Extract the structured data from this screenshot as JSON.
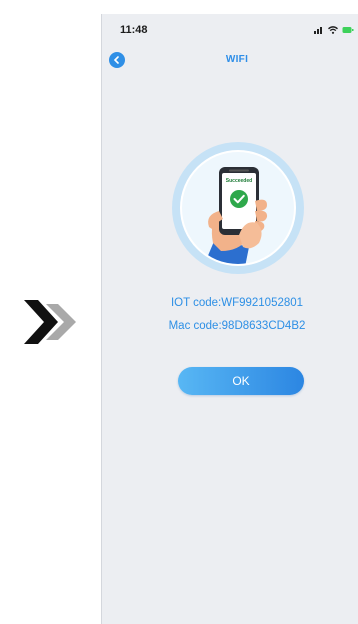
{
  "status_bar": {
    "time": "11:48"
  },
  "nav": {
    "title": "WIFI"
  },
  "illustration": {
    "screen_text": "Succeeded"
  },
  "device_info": {
    "iot_code": "IOT code:WF9921052801",
    "mac_code": "Mac code:98D8633CD4B2"
  },
  "actions": {
    "ok_label": "OK"
  },
  "colors": {
    "accent": "#2e8ee8",
    "button_gradient_start": "#58b7f4",
    "button_gradient_end": "#2c86e2",
    "success": "#2ea84b",
    "background": "#eceef2"
  },
  "icons": [
    "chevron-right-icon",
    "back-icon",
    "signal-icon",
    "wifi-icon",
    "battery-icon",
    "check-icon"
  ]
}
